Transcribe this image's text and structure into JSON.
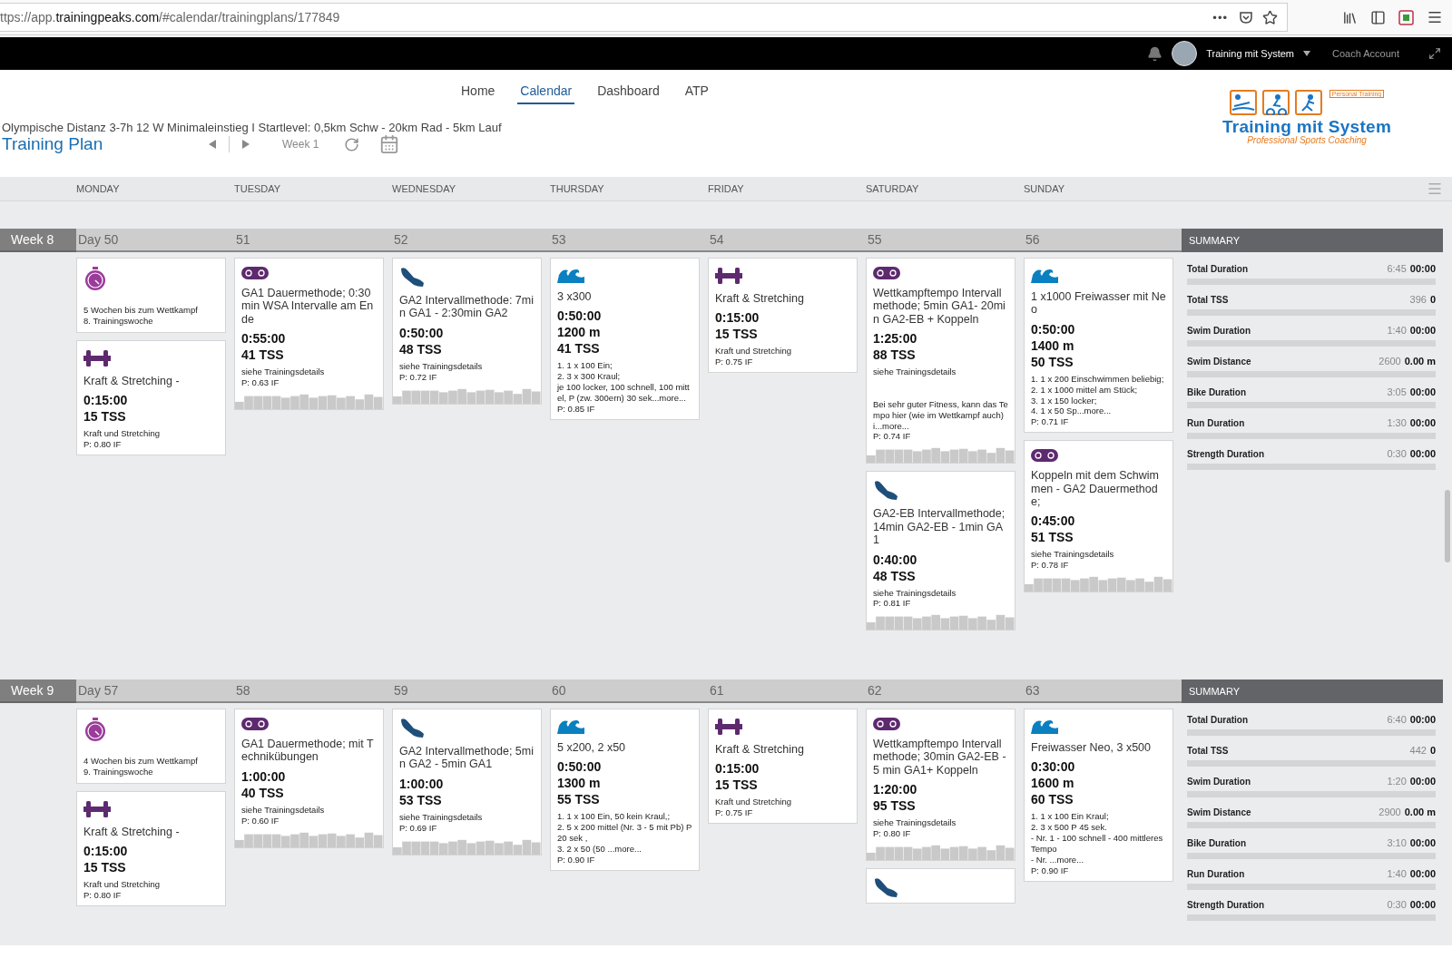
{
  "browser": {
    "url": "ttps://app.**trainingpeaks.com**/#calendar/trainingplans/177849",
    "more": "•••"
  },
  "header": {
    "user_name": "Training mit System",
    "account": "Coach Account"
  },
  "nav": [
    {
      "label": "Home",
      "selected": false
    },
    {
      "label": "Calendar",
      "selected": true
    },
    {
      "label": "Dashboard",
      "selected": false
    },
    {
      "label": "ATP",
      "selected": false
    }
  ],
  "plan": {
    "subtitle": "Olympische Distanz 3-7h 12 W Minimaleinstieg I Startlevel: 0,5km Schw - 20km Rad - 5km Lauf",
    "title": "Training Plan",
    "week": "Week 1"
  },
  "logo": {
    "tag": "Personal Training",
    "name": "Training mit System",
    "tagline": "Professional Sports Coaching"
  },
  "day_headers": [
    "MONDAY",
    "TUESDAY",
    "WEDNESDAY",
    "THURSDAY",
    "FRIDAY",
    "SATURDAY",
    "SUNDAY"
  ],
  "weeks": [
    {
      "label": "Week 8",
      "days": [
        {
          "label": "Day 50",
          "cards": [
            {
              "kind": "event",
              "notes": "5 Wochen bis zum Wettkampf\n8. Trainingswoche"
            },
            {
              "kind": "strength",
              "title": "Kraft & Stretching -",
              "duration": "0:15:00",
              "tss": "15 TSS",
              "notes": "Kraft und Stretching",
              "if": "P: 0.80 IF",
              "graph": false
            }
          ]
        },
        {
          "label": "51",
          "cards": [
            {
              "kind": "bike",
              "title": "GA1 Dauermethode; 0:30min WSA Intervalle am Ende",
              "duration": "0:55:00",
              "tss": "41 TSS",
              "notes": "siehe Trainingsdetails",
              "if": "P: 0.63 IF",
              "graph": true
            }
          ]
        },
        {
          "label": "52",
          "cards": [
            {
              "kind": "run",
              "title": "GA2 Intervallmethode: 7min GA1 - 2:30min GA2",
              "duration": "0:50:00",
              "tss": "48 TSS",
              "notes": "siehe Trainingsdetails",
              "if": "P: 0.72 IF",
              "graph": true
            }
          ]
        },
        {
          "label": "53",
          "cards": [
            {
              "kind": "swim",
              "title": "3 x300",
              "duration": "0:50:00",
              "distance": "1200 m",
              "tss": "41 TSS",
              "notes": "1. 1 x 100 Ein;\n2. 3 x 300 Kraul;\nje 100 locker, 100 schnell, 100 mittel, P (zw. 300ern) 30 sek...more...",
              "if": "P: 0.85 IF",
              "graph": false
            }
          ]
        },
        {
          "label": "54",
          "cards": [
            {
              "kind": "strength",
              "title": "Kraft & Stretching",
              "duration": "0:15:00",
              "tss": "15 TSS",
              "notes": "Kraft und Stretching",
              "if": "P: 0.75 IF",
              "graph": false
            }
          ]
        },
        {
          "label": "55",
          "cards": [
            {
              "kind": "bike",
              "title": "Wettkampftempo Intervallmethode; 5min GA1- 20min GA2-EB + Koppeln",
              "duration": "1:25:00",
              "tss": "88 TSS",
              "notes": "siehe Trainingsdetails\n\n\nBei sehr guter Fitness, kann das Tempo hier (wie im Wettkampf auch) i...more...",
              "if": "P: 0.74 IF",
              "graph": true
            },
            {
              "kind": "run",
              "title": "GA2-EB Intervallmethode; 14min GA2-EB - 1min GA1",
              "duration": "0:40:00",
              "tss": "48 TSS",
              "notes": "siehe Trainingsdetails",
              "if": "P: 0.81 IF",
              "graph": true
            }
          ]
        },
        {
          "label": "56",
          "cards": [
            {
              "kind": "swim",
              "title": "1 x1000 Freiwasser mit Neo",
              "duration": "0:50:00",
              "distance": "1400 m",
              "tss": "50 TSS",
              "notes": "1. 1 x 200 Einschwimmen beliebig;\n2. 1 x 1000 mittel am Stück;\n3. 1 x 150 locker;\n4. 1 x 50 Sp...more...",
              "if": "P: 0.71 IF",
              "graph": false
            },
            {
              "kind": "bike",
              "title": "Koppeln mit dem Schwimmen - GA2 Dauermethode;",
              "duration": "0:45:00",
              "tss": "51 TSS",
              "notes": "siehe Trainingsdetails",
              "if": "P: 0.78 IF",
              "graph": true
            }
          ]
        }
      ],
      "summary": {
        "title": "SUMMARY",
        "rows": [
          {
            "label": "Total Duration",
            "planned": "6:45",
            "completed": "00:00"
          },
          {
            "label": "Total TSS",
            "planned": "396",
            "completed": "0"
          },
          {
            "label": "Swim Duration",
            "planned": "1:40",
            "completed": "00:00"
          },
          {
            "label": "Swim Distance",
            "planned": "2600",
            "completed": "0.00 m"
          },
          {
            "label": "Bike Duration",
            "planned": "3:05",
            "completed": "00:00"
          },
          {
            "label": "Run Duration",
            "planned": "1:30",
            "completed": "00:00"
          },
          {
            "label": "Strength Duration",
            "planned": "0:30",
            "completed": "00:00"
          }
        ]
      }
    },
    {
      "label": "Week 9",
      "days": [
        {
          "label": "Day 57",
          "cards": [
            {
              "kind": "event",
              "notes": "4 Wochen bis zum Wettkampf\n9. Trainingswoche"
            },
            {
              "kind": "strength",
              "title": "Kraft & Stretching -",
              "duration": "0:15:00",
              "tss": "15 TSS",
              "notes": "Kraft und Stretching",
              "if": "P: 0.80 IF",
              "graph": false
            }
          ]
        },
        {
          "label": "58",
          "cards": [
            {
              "kind": "bike",
              "title": "GA1 Dauermethode; mit Technikübungen",
              "duration": "1:00:00",
              "tss": "40 TSS",
              "notes": "siehe Trainingsdetails",
              "if": "P: 0.60 IF",
              "graph": true
            }
          ]
        },
        {
          "label": "59",
          "cards": [
            {
              "kind": "run",
              "title": "GA2 Intervallmethode; 5min GA2 - 5min GA1",
              "duration": "1:00:00",
              "tss": "53 TSS",
              "notes": "siehe Trainingsdetails",
              "if": "P: 0.69 IF",
              "graph": true
            }
          ]
        },
        {
          "label": "60",
          "cards": [
            {
              "kind": "swim",
              "title": "5 x200, 2 x50",
              "duration": "0:50:00",
              "distance": "1300 m",
              "tss": "55 TSS",
              "notes": "1. 1 x 100 Ein, 50 kein Kraul,;\n2. 5 x 200 mittel (Nr. 3 - 5 mit Pb) P 20 sek ,\n3. 2 x 50 (50 ...more...",
              "if": "P: 0.90 IF",
              "graph": false
            }
          ]
        },
        {
          "label": "61",
          "cards": [
            {
              "kind": "strength",
              "title": "Kraft & Stretching",
              "duration": "0:15:00",
              "tss": "15 TSS",
              "notes": "Kraft und Stretching",
              "if": "P: 0.75 IF",
              "graph": false
            }
          ]
        },
        {
          "label": "62",
          "cards": [
            {
              "kind": "bike",
              "title": "Wettkampftempo Intervallmethode; 30min GA2-EB - 5 min GA1+ Koppeln",
              "duration": "1:20:00",
              "tss": "95 TSS",
              "notes": "siehe Trainingsdetails",
              "if": "P: 0.80 IF",
              "graph": true
            },
            {
              "kind": "run"
            }
          ]
        },
        {
          "label": "63",
          "cards": [
            {
              "kind": "swim",
              "title": "Freiwasser Neo, 3 x500",
              "duration": "0:30:00",
              "distance": "1600 m",
              "tss": "60 TSS",
              "notes": "1. 1 x 100 Ein Kraul;\n2. 3 x 500 P 45 sek.\n- Nr. 1 - 100 schnell - 400 mittleres Tempo\n- Nr. ...more...",
              "if": "P: 0.90 IF",
              "graph": false
            }
          ]
        }
      ],
      "summary": {
        "title": "SUMMARY",
        "rows": [
          {
            "label": "Total Duration",
            "planned": "6:40",
            "completed": "00:00"
          },
          {
            "label": "Total TSS",
            "planned": "442",
            "completed": "0"
          },
          {
            "label": "Swim Duration",
            "planned": "1:20",
            "completed": "00:00"
          },
          {
            "label": "Swim Distance",
            "planned": "2900",
            "completed": "0.00 m"
          },
          {
            "label": "Bike Duration",
            "planned": "3:10",
            "completed": "00:00"
          },
          {
            "label": "Run Duration",
            "planned": "1:40",
            "completed": "00:00"
          },
          {
            "label": "Strength Duration",
            "planned": "0:30",
            "completed": "00:00"
          }
        ]
      }
    }
  ]
}
